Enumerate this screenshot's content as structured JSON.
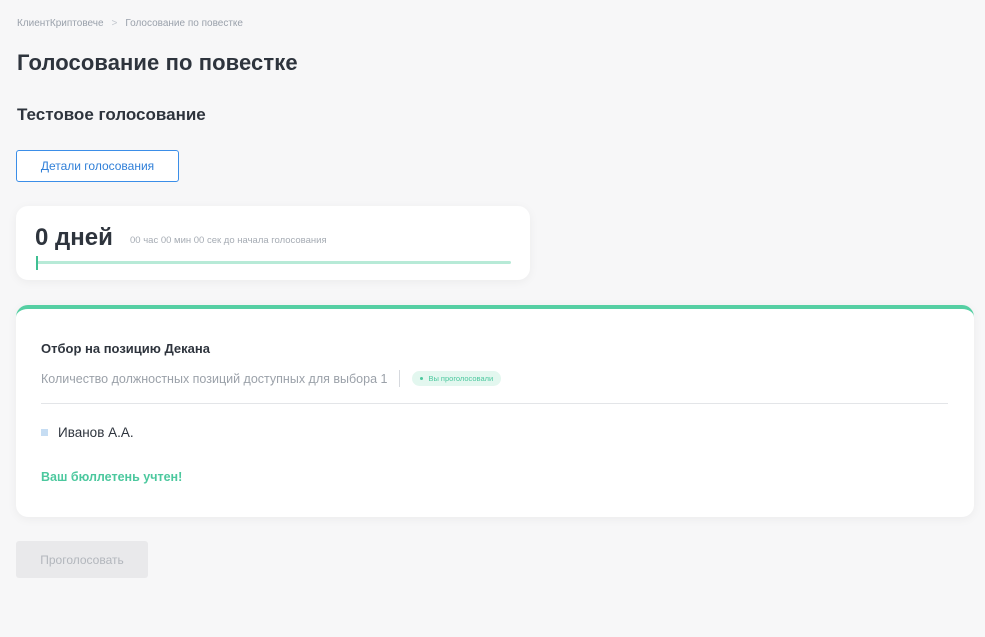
{
  "breadcrumb": {
    "items": [
      "КлиентКриптовече",
      "Голосование по повестке"
    ],
    "separator": ">"
  },
  "page_title": "Голосование по повестке",
  "voting": {
    "name": "Тестовое голосование",
    "details_button_label": "Детали голосования"
  },
  "timer": {
    "days_label": "0 дней",
    "remaining_text": "00 час 00 мин 00 сек до начала голосования",
    "progress_fraction": 0.0
  },
  "ballot": {
    "title": "Отбор на позицию Декана",
    "positions_text": "Количество должностных позиций доступных для выбора 1",
    "status_badge": "Вы проголосовали",
    "candidates": [
      "Иванов А.А."
    ],
    "success_message": "Ваш бюллетень учтен!"
  },
  "actions": {
    "vote_button_label": "Проголосовать",
    "vote_button_disabled": true
  },
  "colors": {
    "accent_green": "#4cc89e",
    "accent_blue": "#3b8ee8",
    "page_background": "#f7f7f8"
  }
}
